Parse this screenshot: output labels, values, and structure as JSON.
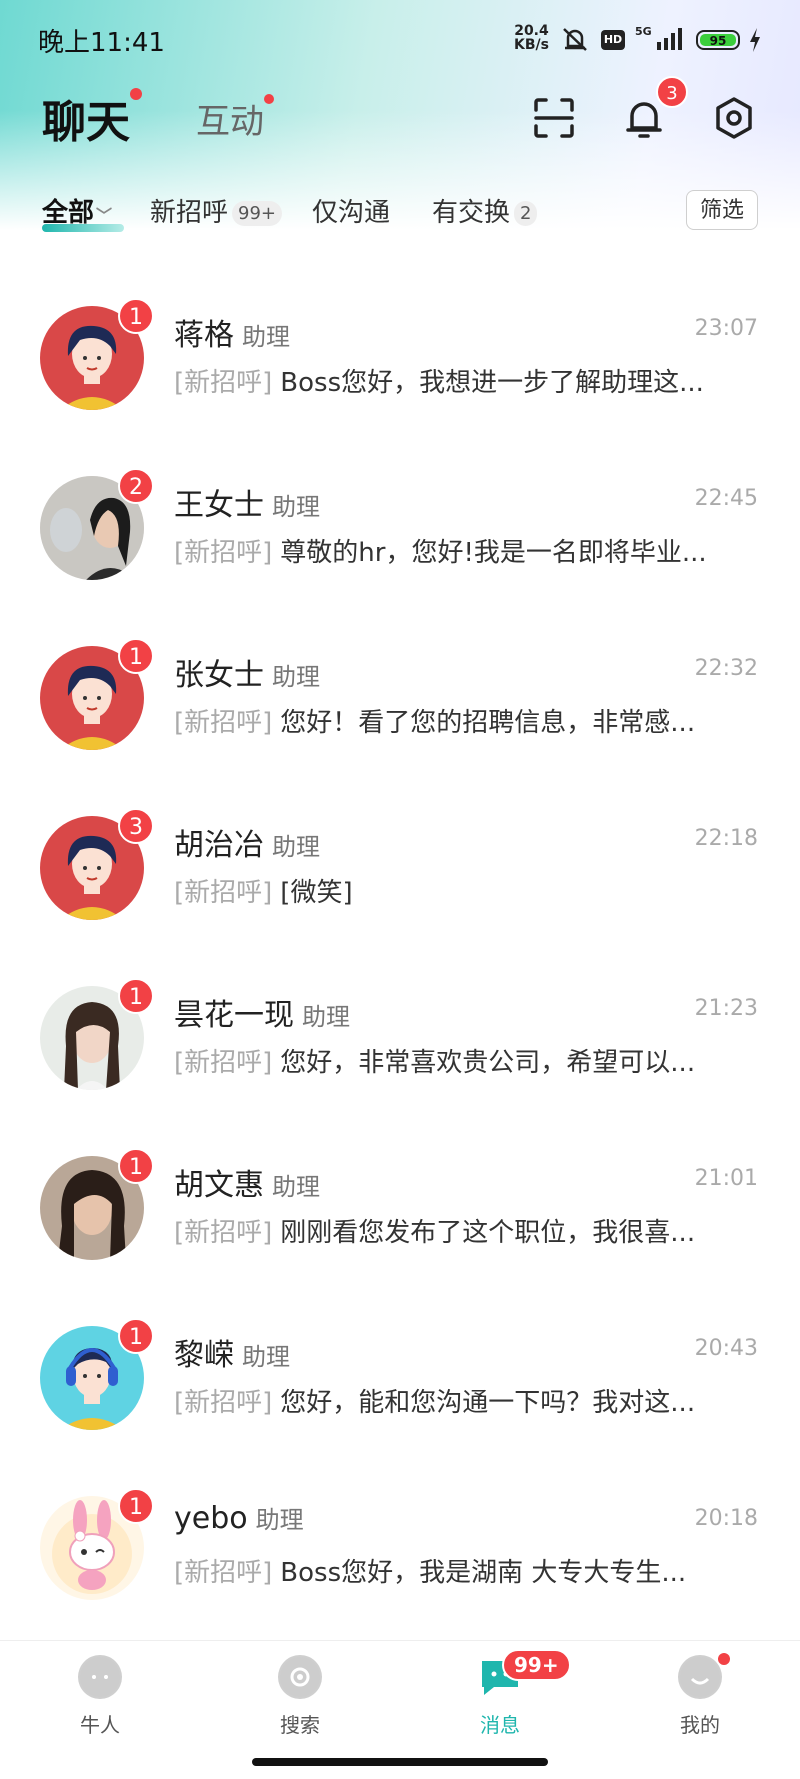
{
  "status_bar": {
    "time": "晚上11:41",
    "net_speed": "20.4",
    "net_unit": "KB/s",
    "hd": "HD",
    "signal": "5G",
    "battery": "95"
  },
  "header": {
    "tab_chat": "聊天",
    "tab_interact": "互动",
    "bell_badge": "3"
  },
  "filter": {
    "tabs": [
      {
        "label": "全部"
      },
      {
        "label": "新招呼",
        "count": "99+"
      },
      {
        "label": "仅沟通"
      },
      {
        "label": "有交换",
        "count": "2"
      }
    ],
    "filter_button": "筛选"
  },
  "conversations": [
    {
      "name": "蒋格",
      "role": "助理",
      "time": "23:07",
      "tag": "[新招呼]",
      "message": "Boss您好，我想进一步了解助理这...",
      "badge": "1",
      "avatar": "female-illustration"
    },
    {
      "name": "王女士",
      "role": "助理",
      "time": "22:45",
      "tag": "[新招呼]",
      "message": "尊敬的hr，您好!我是一名即将毕业...",
      "badge": "2",
      "avatar": "photo"
    },
    {
      "name": "张女士",
      "role": "助理",
      "time": "22:32",
      "tag": "[新招呼]",
      "message": "您好！看了您的招聘信息，非常感...",
      "badge": "1",
      "avatar": "female-illustration"
    },
    {
      "name": "胡治冶",
      "role": "助理",
      "time": "22:18",
      "tag": "[新招呼]",
      "message": "[微笑]",
      "badge": "3",
      "avatar": "female-illustration"
    },
    {
      "name": "昙花一现",
      "role": "助理",
      "time": "21:23",
      "tag": "[新招呼]",
      "message": "您好，非常喜欢贵公司，希望可以...",
      "badge": "1",
      "avatar": "photo"
    },
    {
      "name": "胡文惠",
      "role": "助理",
      "time": "21:01",
      "tag": "[新招呼]",
      "message": "刚刚看您发布了这个职位，我很喜...",
      "badge": "1",
      "avatar": "photo"
    },
    {
      "name": "黎嵘",
      "role": "助理",
      "time": "20:43",
      "tag": "[新招呼]",
      "message": "您好，能和您沟通一下吗？我对这...",
      "badge": "1",
      "avatar": "male-illustration"
    },
    {
      "name": "yebo",
      "role": "助理",
      "time": "20:18",
      "tag": "[新招呼]",
      "message": "Boss您好，我是湖南 大专大专生...",
      "badge": "1",
      "avatar": "bunny-sticker"
    }
  ],
  "bottom_nav": {
    "items": [
      {
        "label": "牛人"
      },
      {
        "label": "搜索"
      },
      {
        "label": "消息"
      },
      {
        "label": "我的"
      }
    ],
    "message_badge": "99+"
  },
  "colors": {
    "accent": "#1fb6ad",
    "badge": "#f24145"
  }
}
